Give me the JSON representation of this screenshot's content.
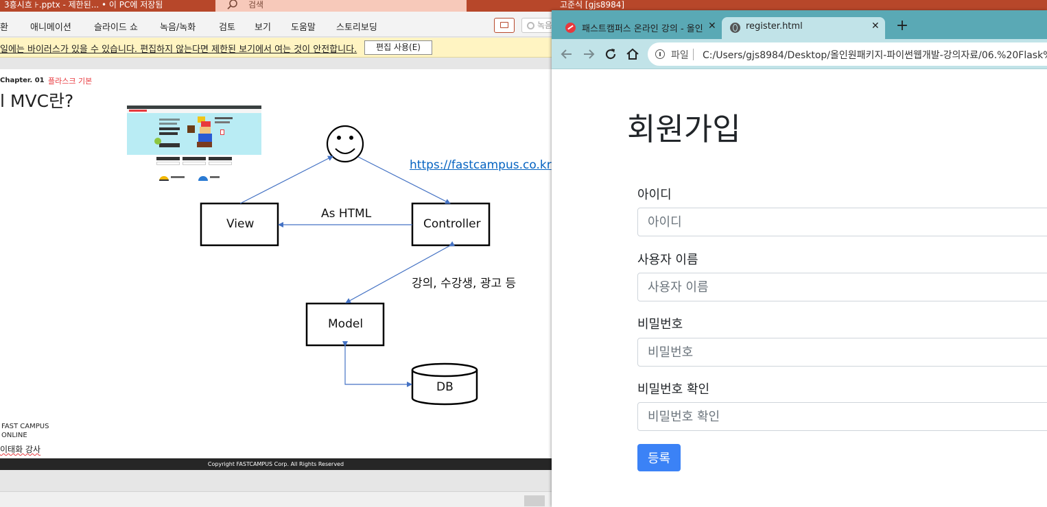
{
  "ppt": {
    "title_doc": "3흥시흐 ⊦.pptx  -  제한된...  •  이 PC에 저장됨",
    "search_placeholder": "검색",
    "user": "고준식 [gjs8984]",
    "menu": [
      "환",
      "애니메이션",
      "슬라이드 쇼",
      "녹음/녹화",
      "검토",
      "보기",
      "도움말",
      "스토리보딩"
    ],
    "record_label": "녹음",
    "warning_text": "일에는 바이러스가 있을 수 있습니다. 편집하지 않는다면 제한된 보기에서 여는 것이 안전합니다.",
    "enable_editing": "편집 사용(E)"
  },
  "slide": {
    "chapter": "Chapter.   01",
    "chapter_sub": "플라스크 기본",
    "title": "l MVC란?",
    "url": "https://fastcampus.co.kr",
    "nodes": {
      "view": "View",
      "controller": "Controller",
      "model": "Model",
      "db": "DB"
    },
    "edge_html": "As HTML",
    "edge_data": "강의, 수강생, 광고 등",
    "footer_org_line1": "FAST CAMPUS",
    "footer_org_line2": "ONLINE",
    "footer_lecturer": "이태화 강사",
    "copyright": "Copyright FASTCAMPUS Corp. All Rights Reserved"
  },
  "browser": {
    "tabs": [
      {
        "title": "패스트캠퍼스 온라인 강의 - 올인",
        "close": "✕"
      },
      {
        "title": "register.html",
        "close": "✕"
      }
    ],
    "new_tab": "+",
    "omnibox": {
      "scheme": "파일",
      "url": "C:/Users/gjs8984/Desktop/올인원패키지-파이썬웹개발-강의자료/06.%20Flask%"
    }
  },
  "form": {
    "heading": "회원가입",
    "fields": [
      {
        "label": "아이디",
        "placeholder": "아이디"
      },
      {
        "label": "사용자 이름",
        "placeholder": "사용자 이름"
      },
      {
        "label": "비밀번호",
        "placeholder": "비밀번호"
      },
      {
        "label": "비밀번호 확인",
        "placeholder": "비밀번호 확인"
      }
    ],
    "submit": "등록"
  },
  "colors": {
    "ppt_red": "#b7472a",
    "chrome_tab": "#5aa9b5",
    "chrome_toolbar": "#c1e3e8",
    "primary": "#3b82f6",
    "link": "#0563c1"
  }
}
